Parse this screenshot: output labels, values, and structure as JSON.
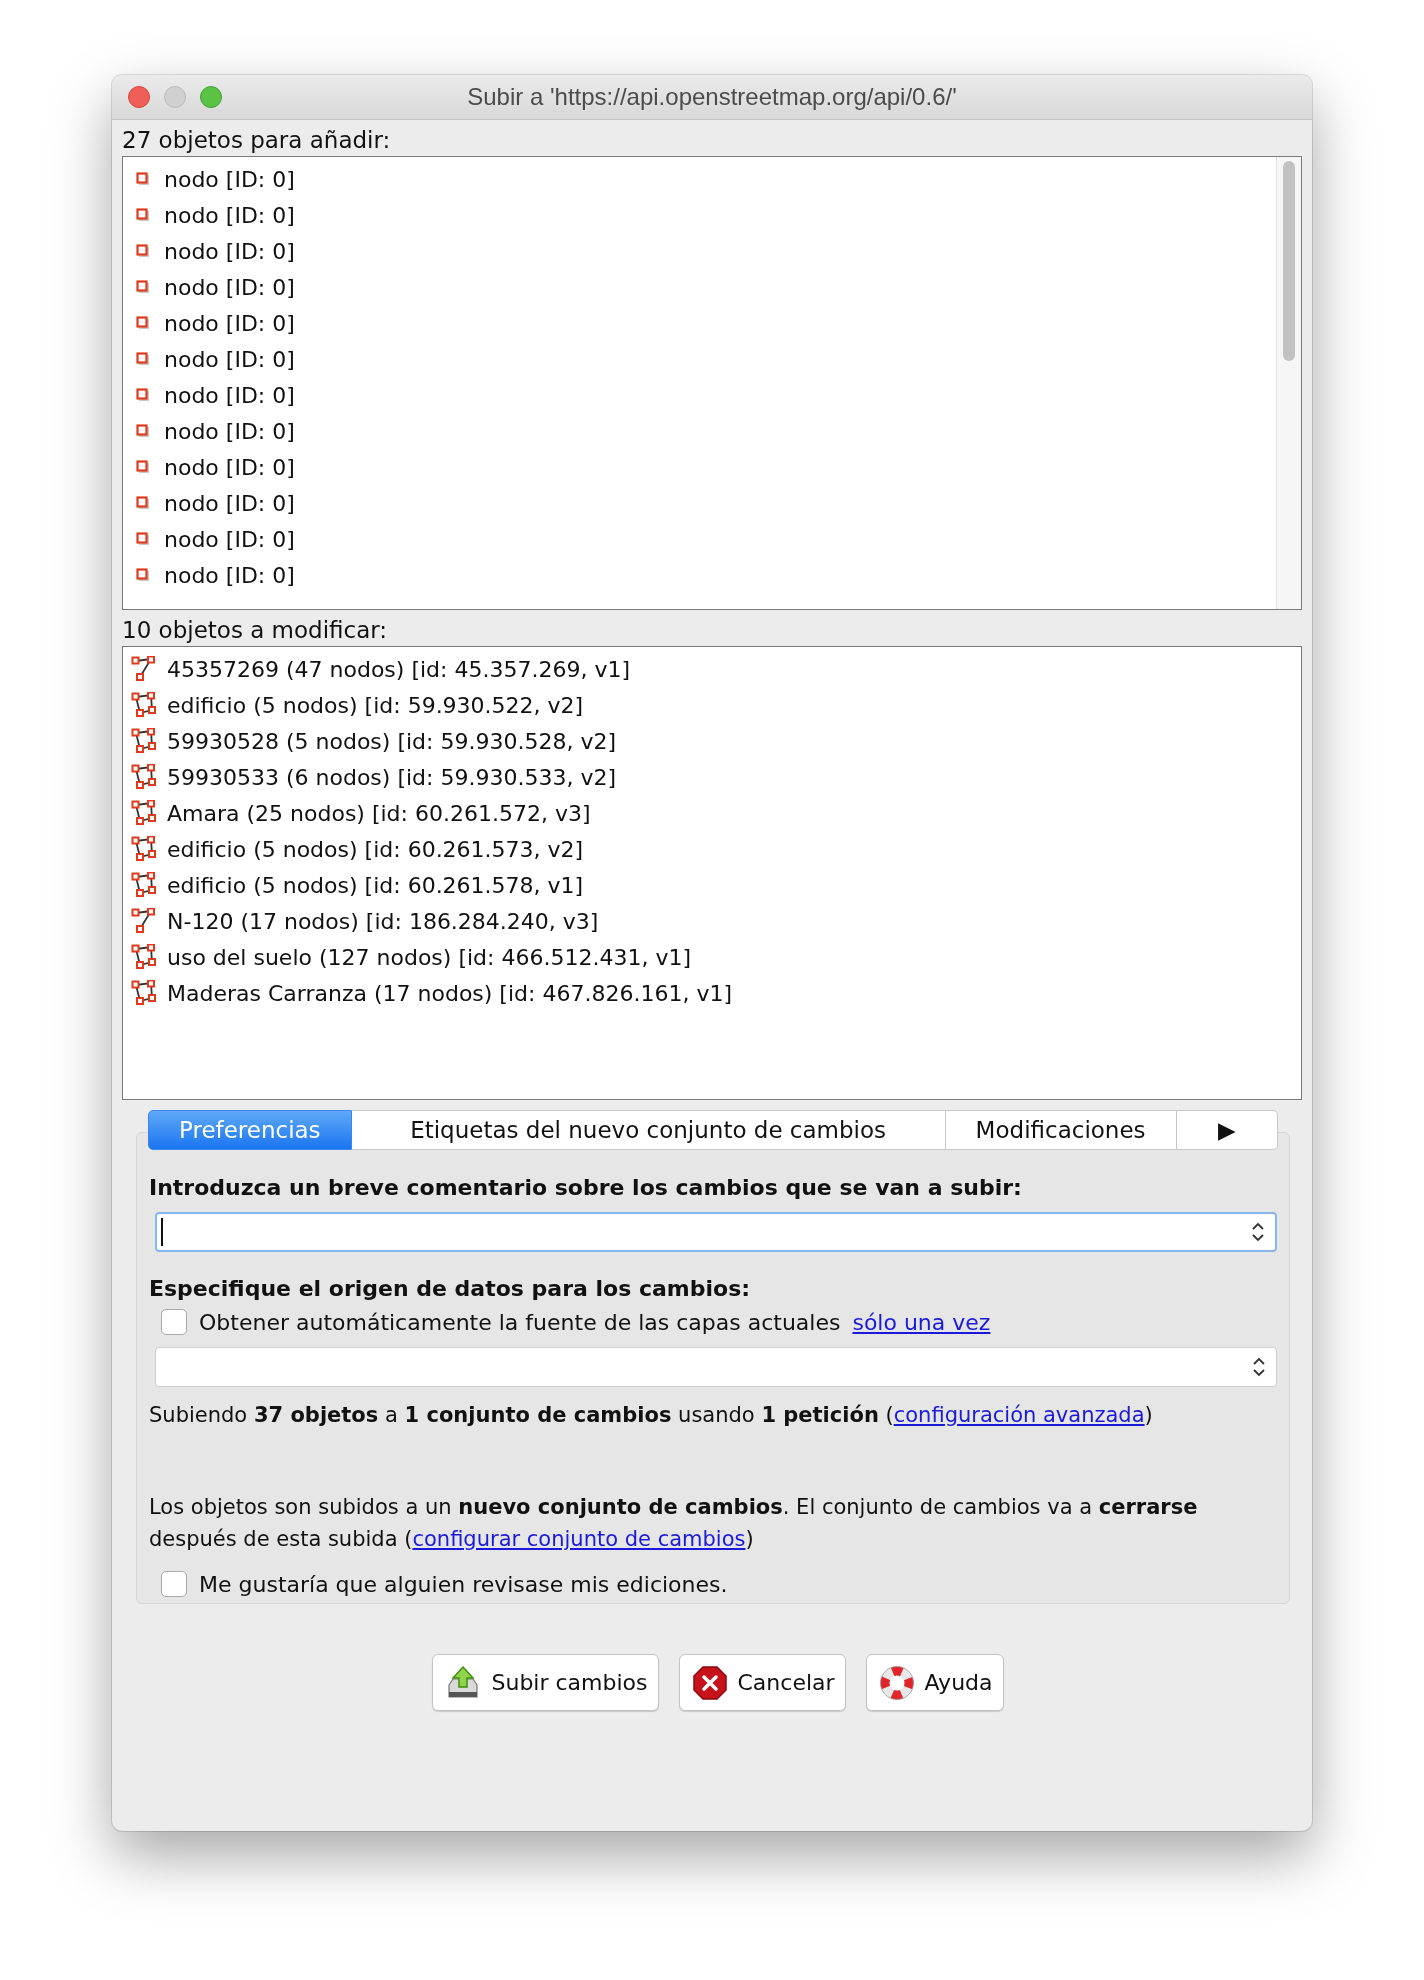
{
  "window": {
    "title": "Subir a 'https://api.openstreetmap.org/api/0.6/'"
  },
  "add_section": {
    "label": "27 objetos para añadir:",
    "items": [
      {
        "kind": "node",
        "label": "nodo [ID: 0]"
      },
      {
        "kind": "node",
        "label": "nodo [ID: 0]"
      },
      {
        "kind": "node",
        "label": "nodo [ID: 0]"
      },
      {
        "kind": "node",
        "label": "nodo [ID: 0]"
      },
      {
        "kind": "node",
        "label": "nodo [ID: 0]"
      },
      {
        "kind": "node",
        "label": "nodo [ID: 0]"
      },
      {
        "kind": "node",
        "label": "nodo [ID: 0]"
      },
      {
        "kind": "node",
        "label": "nodo [ID: 0]"
      },
      {
        "kind": "node",
        "label": "nodo [ID: 0]"
      },
      {
        "kind": "node",
        "label": "nodo [ID: 0]"
      },
      {
        "kind": "node",
        "label": "nodo [ID: 0]"
      },
      {
        "kind": "node",
        "label": "nodo [ID: 0]"
      }
    ]
  },
  "modify_section": {
    "label": "10 objetos a modificar:",
    "items": [
      {
        "kind": "way",
        "label": "45357269 (47 nodos) [id: 45.357.269, v1]"
      },
      {
        "kind": "area",
        "label": "edificio (5 nodos) [id: 59.930.522, v2]"
      },
      {
        "kind": "area",
        "label": "59930528 (5 nodos) [id: 59.930.528, v2]"
      },
      {
        "kind": "area",
        "label": "59930533 (6 nodos) [id: 59.930.533, v2]"
      },
      {
        "kind": "area",
        "label": "Amara (25 nodos) [id: 60.261.572, v3]"
      },
      {
        "kind": "area",
        "label": "edificio (5 nodos) [id: 60.261.573, v2]"
      },
      {
        "kind": "area",
        "label": "edificio (5 nodos) [id: 60.261.578, v1]"
      },
      {
        "kind": "way",
        "label": "N-120 (17 nodos) [id: 186.284.240, v3]"
      },
      {
        "kind": "area",
        "label": "uso del suelo (127 nodos) [id: 466.512.431, v1]"
      },
      {
        "kind": "area",
        "label": "Maderas Carranza (17 nodos) [id: 467.826.161, v1]"
      }
    ]
  },
  "tabs": [
    {
      "label": "Preferencias",
      "selected": true
    },
    {
      "label": "Etiquetas del nuevo conjunto de cambios",
      "selected": false
    },
    {
      "label": "Modificaciones",
      "selected": false
    }
  ],
  "tab_overflow": "▶",
  "comment": {
    "label": "Introduzca un breve comentario sobre los cambios que se van a subir:",
    "focused": true
  },
  "source": {
    "label": "Especifique el origen de datos para los cambios:",
    "checkbox_label": "Obtener automáticamente la fuente de las capas actuales",
    "checked": false,
    "link": "sólo una vez",
    "focused": false
  },
  "summary": {
    "text": "Subiendo **37 objetos** a **1 conjunto de cambios** usando **1 petición** (",
    "link": "configuración avanzada",
    "after": ")"
  },
  "changeset_note": {
    "text": "Los objetos son subidos a un **nuevo conjunto de cambios**. El conjunto de cambios va a **cerrarse** después de esta subida (",
    "link": "configurar conjunto de cambios",
    "after": ")"
  },
  "review": {
    "label": "Me gustaría que alguien revisase mis ediciones.",
    "checked": false
  },
  "buttons": [
    {
      "kind": "upload",
      "label": "Subir cambios"
    },
    {
      "kind": "cancel",
      "label": "Cancelar"
    },
    {
      "kind": "help",
      "label": "Ayuda"
    }
  ]
}
